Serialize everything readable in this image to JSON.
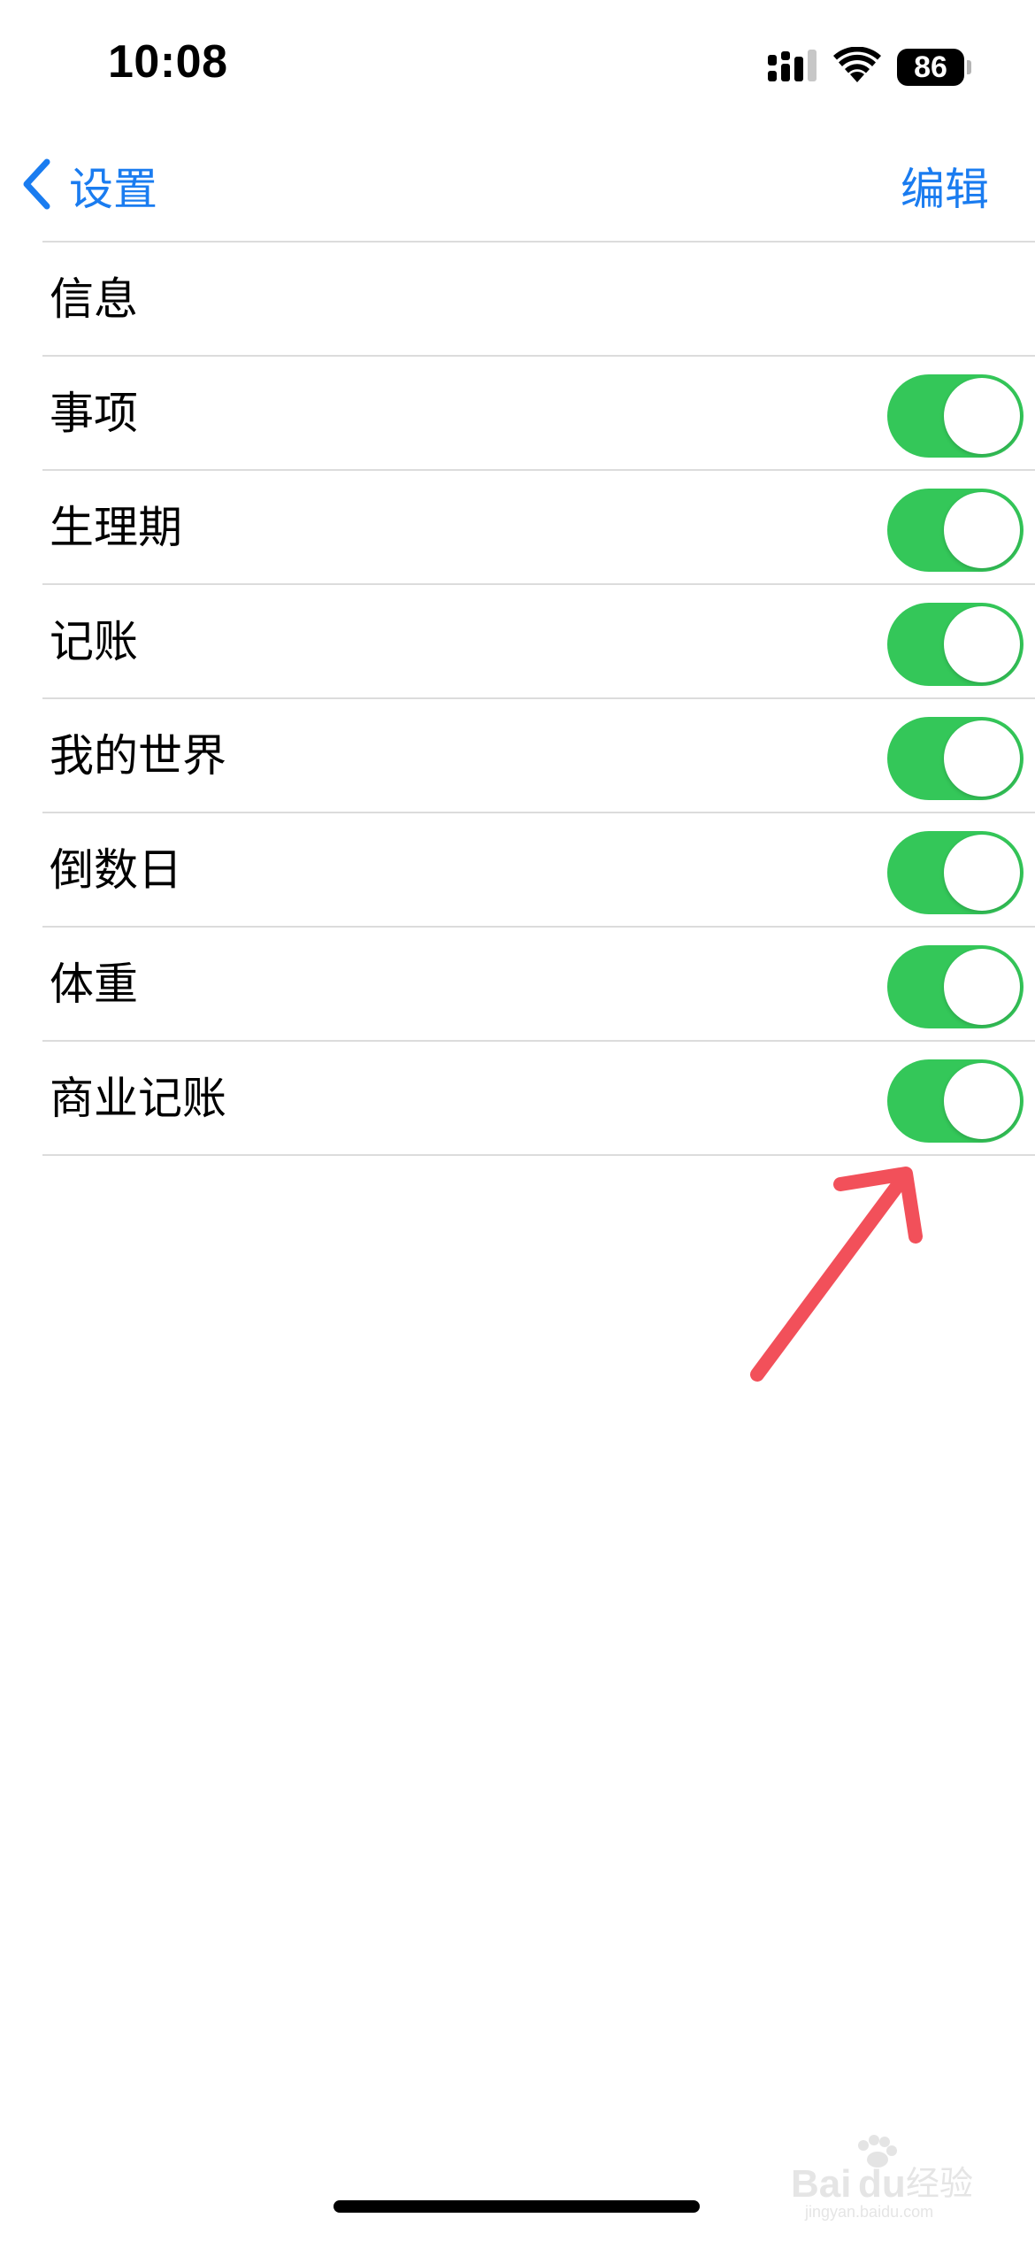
{
  "status_bar": {
    "time": "10:08",
    "battery_level": "86",
    "icons": [
      "cellular-signal-icon",
      "wifi-icon",
      "battery-icon"
    ]
  },
  "nav": {
    "back_label": "设置",
    "back_icon": "chevron-left-icon",
    "edit_label": "编辑"
  },
  "items": [
    {
      "label": "信息",
      "has_toggle": false
    },
    {
      "label": "事项",
      "has_toggle": true,
      "on": true
    },
    {
      "label": "生理期",
      "has_toggle": true,
      "on": true
    },
    {
      "label": "记账",
      "has_toggle": true,
      "on": true
    },
    {
      "label": "我的世界",
      "has_toggle": true,
      "on": true
    },
    {
      "label": "倒数日",
      "has_toggle": true,
      "on": true
    },
    {
      "label": "体重",
      "has_toggle": true,
      "on": true
    },
    {
      "label": "商业记账",
      "has_toggle": true,
      "on": true
    }
  ],
  "colors": {
    "accent": "#1a7cf0",
    "toggle_on": "#34c759",
    "annotation_arrow": "#f2505a"
  },
  "watermark": {
    "brand": "Baidu 经验",
    "url": "jingyan.baidu.com"
  }
}
